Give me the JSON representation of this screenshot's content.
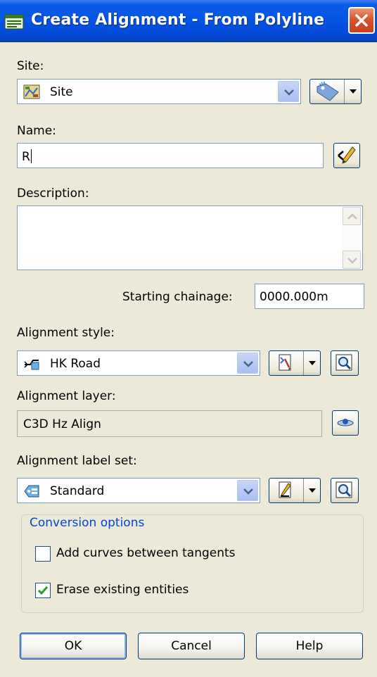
{
  "window": {
    "title": "Create Alignment - From Polyline"
  },
  "site": {
    "label": "Site:",
    "value": "Site"
  },
  "name": {
    "label": "Name:",
    "value": "R"
  },
  "description": {
    "label": "Description:",
    "value": ""
  },
  "starting_chainage": {
    "label": "Starting chainage:",
    "value": "0000.000m"
  },
  "alignment_style": {
    "label": "Alignment style:",
    "value": "HK Road"
  },
  "alignment_layer": {
    "label": "Alignment layer:",
    "value": "C3D Hz Align"
  },
  "alignment_label_set": {
    "label": "Alignment label set:",
    "value": "Standard"
  },
  "conversion_options": {
    "legend": "Conversion options",
    "add_curves": {
      "label": "Add curves between tangents",
      "checked": false
    },
    "erase_entities": {
      "label": "Erase existing entities",
      "checked": true
    }
  },
  "buttons": {
    "ok": "OK",
    "cancel": "Cancel",
    "help": "Help"
  },
  "colors": {
    "title_bar": "#0554e3",
    "dialog_bg": "#ece9d8",
    "group_legend": "#0046d5",
    "close_button": "#d9552a"
  }
}
